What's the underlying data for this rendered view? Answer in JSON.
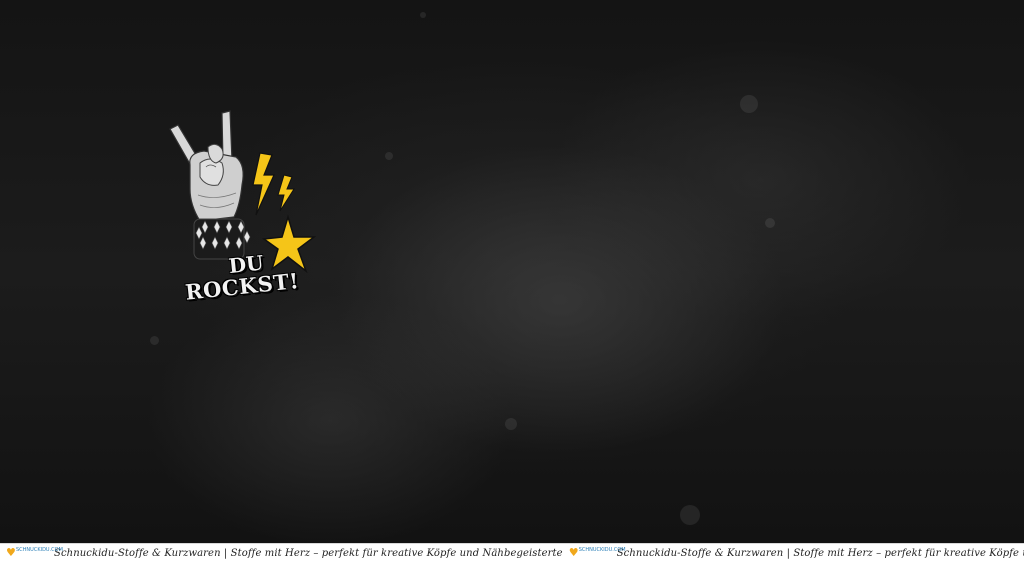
{
  "motif": {
    "line1": "DU",
    "line2": "ROCKST!",
    "accent_color": "#f5c518",
    "icons": [
      "rock-hand-icon",
      "lightning-bolt-icon",
      "star-burst-icon"
    ]
  },
  "footer": {
    "logo_text": "SCHNUCKIDU.COM",
    "text": "Schnuckidu-Stoffe & Kurzwaren | Stoffe mit Herz – perfekt für kreative Köpfe und Nähbegeisterte",
    "background": "#ffffff"
  },
  "background_color": "#1a1a1a"
}
